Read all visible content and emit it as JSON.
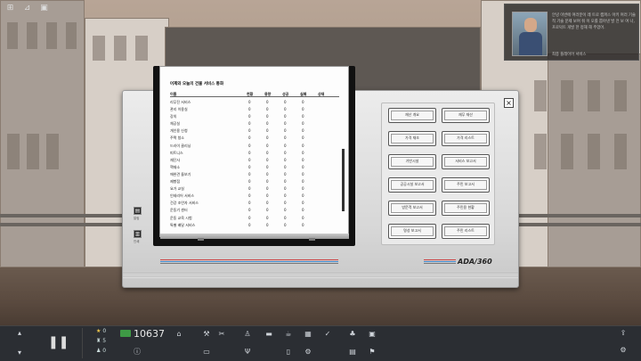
{
  "notification": {
    "text": "안녕 이번에 여러분이 레 트로 캠퍼스 아키 여러 기술 적 기술 문제 보여 줘 이 오를 뽑아낸 발 전 보 여 나, 프로덕트 개발 한 정해 해 주었어.",
    "sender": "최종 플레이어 서비스",
    "icon": "character-portrait"
  },
  "paper": {
    "title": "어제와 오늘의 건물 서비스 통화",
    "headers": [
      "이름",
      "현황",
      "용량",
      "성공",
      "실패",
      "상태"
    ],
    "rows": [
      {
        "name": "리무진 서비스",
        "v": [
          "0",
          "0",
          "0",
          "0"
        ]
      },
      {
        "name": "관리 이용실",
        "v": [
          "0",
          "0",
          "0",
          "0"
        ]
      },
      {
        "name": "강의",
        "v": [
          "0",
          "0",
          "0",
          "0"
        ]
      },
      {
        "name": "체공실",
        "v": [
          "0",
          "0",
          "0",
          "0"
        ]
      },
      {
        "name": "개인용 신청",
        "v": [
          "0",
          "0",
          "0",
          "0"
        ]
      },
      {
        "name": "주택 청소",
        "v": [
          "0",
          "0",
          "0",
          "0"
        ]
      },
      {
        "name": "드라이 클리닝",
        "v": [
          "0",
          "0",
          "0",
          "0"
        ]
      },
      {
        "name": "피트니스",
        "v": [
          "0",
          "0",
          "0",
          "0"
        ]
      },
      {
        "name": "재단사",
        "v": [
          "0",
          "0",
          "0",
          "0"
        ]
      },
      {
        "name": "핵재소",
        "v": [
          "0",
          "0",
          "0",
          "0"
        ]
      },
      {
        "name": "애완견 돌보기",
        "v": [
          "0",
          "0",
          "0",
          "0"
        ]
      },
      {
        "name": "제빵점",
        "v": [
          "0",
          "0",
          "0",
          "0"
        ]
      },
      {
        "name": "요가 교실",
        "v": [
          "0",
          "0",
          "0",
          "0"
        ]
      },
      {
        "name": "인테리어 서비스",
        "v": [
          "0",
          "0",
          "0",
          "0"
        ]
      },
      {
        "name": "건강 조언자 서비스",
        "v": [
          "0",
          "0",
          "0",
          "0"
        ]
      },
      {
        "name": "운동기 센터",
        "v": [
          "0",
          "0",
          "0",
          "0"
        ]
      },
      {
        "name": "운동 교육 시험",
        "v": [
          "0",
          "0",
          "0",
          "0"
        ]
      },
      {
        "name": "특별 배달 서비스",
        "v": [
          "0",
          "0",
          "0",
          "0"
        ]
      }
    ]
  },
  "buttons": [
    "재산 개요",
    "재무 재산",
    "가격 재조",
    "가격 리스트",
    "기반시설",
    "서비스 보고서",
    "공공시설 보고서",
    "주민 보고서",
    "방문객 보고서",
    "주민용 현황",
    "명성 보고서",
    "주민 리스트"
  ],
  "brand": "ADA/360",
  "close_label": "×",
  "side_labels": [
    "알림",
    "인쇄"
  ],
  "toolbar": {
    "money": "10637",
    "stat1": "0",
    "stat2": "5",
    "stat3": "0"
  },
  "colors": {
    "accent_green": "#3e9a45",
    "star": "#f2c94c",
    "toolbar": "#2b2e33"
  }
}
